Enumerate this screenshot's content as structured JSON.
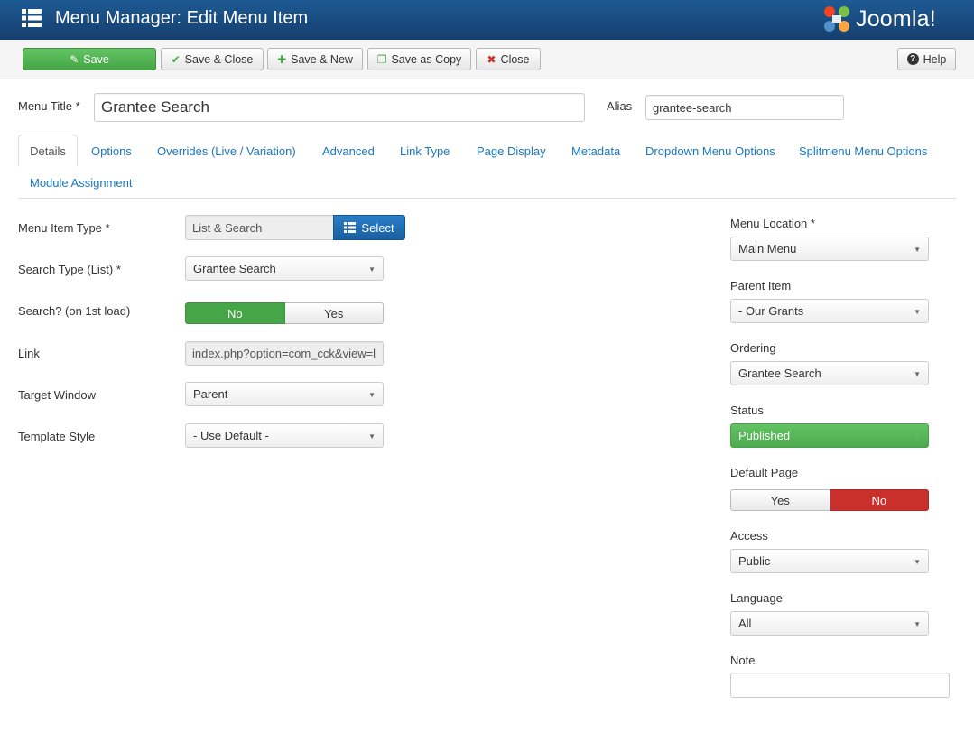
{
  "header": {
    "title": "Menu Manager: Edit Menu Item",
    "logo_text": "Joomla!"
  },
  "toolbar": {
    "save": "Save",
    "save_close": "Save & Close",
    "save_new": "Save & New",
    "save_copy": "Save as Copy",
    "close": "Close",
    "help": "Help"
  },
  "title_row": {
    "menu_title_label": "Menu Title *",
    "menu_title_value": "Grantee Search",
    "alias_label": "Alias",
    "alias_value": "grantee-search"
  },
  "tabs": [
    "Details",
    "Options",
    "Overrides (Live / Variation)",
    "Advanced",
    "Link Type",
    "Page Display",
    "Metadata",
    "Dropdown Menu Options",
    "Splitmenu Menu Options",
    "Module Assignment"
  ],
  "details": {
    "menu_item_type_label": "Menu Item Type *",
    "menu_item_type_value": "List & Search",
    "select_button": "Select",
    "search_type_label": "Search Type (List) *",
    "search_type_value": "Grantee Search",
    "search_first_load_label": "Search? (on 1st load)",
    "search_no": "No",
    "search_yes": "Yes",
    "link_label": "Link",
    "link_value": "index.php?option=com_cck&view=l",
    "target_window_label": "Target Window",
    "target_window_value": "Parent",
    "template_style_label": "Template Style",
    "template_style_value": "- Use Default -"
  },
  "sidebar": {
    "menu_location_label": "Menu Location *",
    "menu_location_value": "Main Menu",
    "parent_item_label": "Parent Item",
    "parent_item_value": "- Our Grants",
    "ordering_label": "Ordering",
    "ordering_value": "Grantee Search",
    "status_label": "Status",
    "status_value": "Published",
    "default_page_label": "Default Page",
    "default_yes": "Yes",
    "default_no": "No",
    "access_label": "Access",
    "access_value": "Public",
    "language_label": "Language",
    "language_value": "All",
    "note_label": "Note",
    "note_value": ""
  },
  "colors": {
    "header": "#1e5a93",
    "success": "#46a546",
    "danger": "#c9302c",
    "link": "#1a78c2",
    "primary": "#1a5fa0"
  }
}
